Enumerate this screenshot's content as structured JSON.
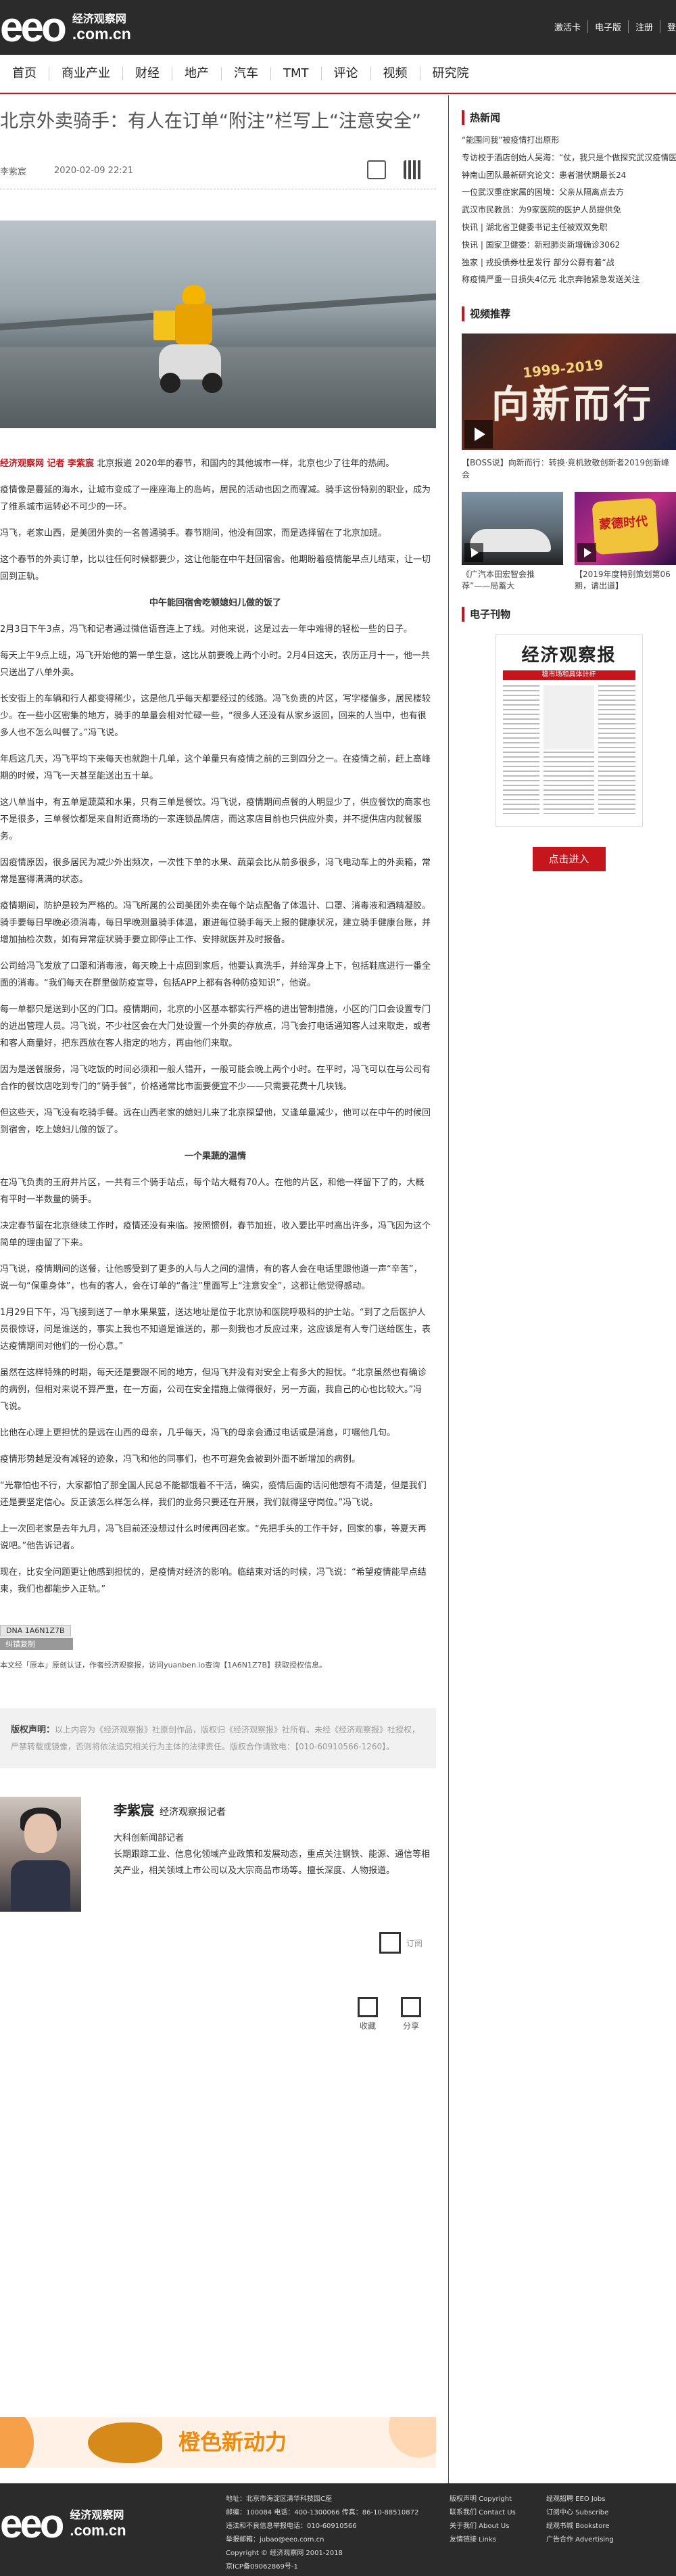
{
  "header": {
    "logo_mark": "eeo",
    "logo_cn": "经济观察网",
    "logo_en": ".com.cn",
    "links": [
      "激活卡",
      "电子版",
      "注册",
      "登"
    ]
  },
  "nav": [
    "首页",
    "商业产业",
    "财经",
    "地产",
    "汽车",
    "TMT",
    "评论",
    "视频",
    "研究院"
  ],
  "article": {
    "title": "北京外卖骑手：有人在订单“附注”栏写上“注意安全”",
    "author": "李紫宸",
    "date": "2020-02-09 22:21",
    "lead_source": "经济观察网 记者 李紫宸",
    "paragraphs": [
      "北京报道 2020年的春节，和国内的其他城市一样，北京也少了往年的热闹。",
      "疫情像是蔓延的海水，让城市变成了一座座海上的岛屿，居民的活动也因之而骤减。骑手这份特别的职业，成为了维系城市运转必不可少的一环。",
      "冯飞，老家山西，是美团外卖的一名普通骑手。春节期间，他没有回家，而是选择留在了北京加班。",
      "这个春节的外卖订单，比以往任何时候都要少，这让他能在中午赶回宿舍。他期盼着疫情能早点儿结束，让一切回到正轨。"
    ],
    "subhead1": "中午能回宿舍吃顿媳妇儿做的饭了",
    "paragraphs2": [
      "2月3日下午3点，冯飞和记者通过微信语音连上了线。对他来说，这是过去一年中难得的轻松一些的日子。",
      "每天上午9点上班，冯飞开始他的第一单生意，这比从前要晚上两个小时。2月4日这天，农历正月十一，他一共只送出了八单外卖。",
      "长安街上的车辆和行人都变得稀少，这是他几乎每天都要经过的线路。冯飞负责的片区，写字楼偏多，居民楼较少。在一些小区密集的地方，骑手的单量会相对忙碌一些，“很多人还没有从家乡返回，回来的人当中，也有很多人也不怎么叫餐了。”冯飞说。",
      "年后这几天，冯飞平均下来每天也就跑十几单，这个单量只有疫情之前的三到四分之一。在疫情之前，赶上高峰期的时候，冯飞一天甚至能送出五十单。",
      "这八单当中，有五单是蔬菜和水果，只有三单是餐饮。冯飞说，疫情期间点餐的人明显少了，供应餐饮的商家也不是很多，三单餐饮都是来自附近商场的一家连锁品牌店，而这家店目前也只供应外卖，并不提供店内就餐服务。",
      "因疫情原因，很多居民为减少外出频次，一次性下单的水果、蔬菜会比从前多很多，冯飞电动车上的外卖箱，常常是塞得满满的状态。",
      "疫情期间，防护是较为严格的。冯飞所属的公司美团外卖在每个站点配备了体温计、口罩、消毒液和酒精凝胶。骑手要每日早晚必须消毒，每日早晚测量骑手体温，跟进每位骑手每天上报的健康状况，建立骑手健康台账，并增加抽检次数，如有异常症状骑手要立即停止工作、安排就医并及时报备。",
      "公司给冯飞发放了口罩和消毒液，每天晚上十点回到家后，他要认真洗手，并给浑身上下，包括鞋底进行一番全面的消毒。“我们每天在群里做防疫宣导，包括APP上都有各种防疫知识”，他说。",
      "每一单都只是送到小区的门口。疫情期间，北京的小区基本都实行严格的进出管制措施，小区的门口会设置专门的进出管理人员。冯飞说，不少社区会在大门处设置一个外卖的存放点，冯飞会打电话通知客人过来取走，或者和客人商量好，把东西放在客人指定的地方，再由他们来取。",
      "因为是送餐服务，冯飞吃饭的时间必须和一般人错开，一般可能会晚上两个小时。在平时，冯飞可以在与公司有合作的餐饮店吃到专门的“骑手餐”，价格通常比市面要便宜不少——只需要花费十几块钱。",
      "但这些天，冯飞没有吃骑手餐。远在山西老家的媳妇儿来了北京探望他，又逢单量减少，他可以在中午的时候回到宿舍，吃上媳妇儿做的饭了。"
    ],
    "subhead2": "一个果蔬的温情",
    "paragraphs3": [
      "在冯飞负责的王府井片区，一共有三个骑手站点，每个站大概有70人。在他的片区，和他一样留下了的，大概有平时一半数量的骑手。",
      "决定春节留在北京继续工作时，疫情还没有来临。按照惯例，春节加班，收入要比平时高出许多，冯飞因为这个简单的理由留了下来。",
      "冯飞说，疫情期间的送餐，让他感受到了更多的人与人之间的温情，有的客人会在电话里跟他道一声“辛苦”，说一句“保重身体”，也有的客人，会在订单的“备注”里面写上“注意安全”，这都让他觉得感动。",
      "1月29日下午，冯飞接到送了一单水果果篮，送达地址是位于北京协和医院呼吸科的护士站。“到了之后医护人员很惊讶，问是谁送的，事实上我也不知道是谁送的，那一刻我也才反应过来，这应该是有人专门送给医生，表达疫情期间对他们的一份心意。”",
      "虽然在这样特殊的时期，每天还是要跟不同的地方，但冯飞并没有对安全上有多大的担忧。“北京虽然也有确诊的病例，但相对来说不算严重，在一方面，公司在安全措施上做得很好，另一方面，我自己的心也比较大。”冯飞说。",
      "比他在心理上更担忧的是远在山西的母亲，几乎每天，冯飞的母亲会通过电话或是消息，叮嘱他几句。",
      "疫情形势越是没有减轻的迹象，冯飞和他的同事们，也不可避免会被到外面不断增加的病例。",
      "“光靠怕也不行，大家都怕了那全国人民总不能都饿着不干活，确实，疫情后面的话问他想有不清楚，但是我们还是要坚定信心。反正该怎么样怎么样，我们的业务只要还在开展，我们就得坚守岗位。”冯飞说。",
      "上一次回老家是去年九月，冯飞目前还没想过什么时候再回老家。“先把手头的工作干好，回家的事，等夏天再说吧。”他告诉记者。",
      "现在，比安全问题更让他感到担忧的，是疫情对经济的影响。临结束对话的时候，冯飞说：“希望疫情能早点结束，我们也都能步入正轨。”"
    ],
    "dna_label": "DNA 1A6N1Z7B",
    "dna_sub": "纠错复制",
    "copyright_line": "本文经「原本」原创认证，作者经济观察报，访问yuanben.io查询【1A6N1Z7B】获取授权信息。",
    "rights_title": "版权声明：",
    "rights_text": "以上内容为《经济观察报》社原创作品，版权归《经济观察报》社所有。未经《经济观察报》社授权，严禁转载或镜像，否则将依法追究相关行为主体的法律责任。版权合作请致电：【010-60910566-1260】。",
    "author_box": {
      "name": "李紫宸",
      "role": "经济观察报记者",
      "title": "大科创新闻部记者",
      "bio": "长期跟踪工业、信息化领域产业政策和发展动态，重点关注钢铁、能源、通信等相关产业，相关领域上市公司以及大宗商品市场等。擅长深度、人物报道。"
    },
    "subscribe_label": "订阅",
    "collect_label": "收藏",
    "share_label": "分享",
    "banner_text": "橙色新动力"
  },
  "sidebar": {
    "hot_title": "热新闻",
    "hot_items": [
      "“能围问我”被疫情打出原形",
      "专访校于酒店创始人吴海：“仗，我只是个做探究武汉疫情医护健康",
      "钟南山团队最新研究论文：患者潜伏期最长24",
      "一位武汉重症家属的困境：父亲从隔离点去方",
      "武汉市民教员：为9家医院的医护人员提供免",
      "快讯 | 湖北省卫健委书记主任被双双免职",
      "快讯 | 国家卫健委：新冠肺炎新增确诊3062",
      "独家 | 戎投债券杜星发行 部分公募有着“战",
      "称疫情严重一日损失4亿元 北京奔驰紧急发送关注"
    ],
    "video_title": "视频推荐",
    "video_big_t1": "1999-2019",
    "video_big_t2": "向新而行",
    "video_big_caption": "【BOSS说】向新而行：转换·竞机致敬创新者2019创新峰会",
    "video_small": [
      {
        "caption": "《广汽本田宏智会推荐”——局蓄大",
        "badge": ""
      },
      {
        "caption": "【2019年度特别策划第06期，请出道】",
        "badge": "蒙德时代"
      }
    ],
    "paper_title": "电子刊物",
    "paper_name": "经济观察报",
    "paper_head": "稳市场和具体计杆",
    "enter_label": "点击进入"
  },
  "footer": {
    "address": [
      "地址：北京市海淀区清华科技园C座",
      "邮编：100084 电话：400-1300066 传真：86-10-88510872",
      "违法和不良信息举报电话：010-60910566",
      "举报邮箱：jubao@eeo.com.cn",
      "Copyright © 经济观察网 2001-2018",
      "京ICP备09062869号-1"
    ],
    "links1": [
      "版权声明 Copyright",
      "联系我们 Contact Us",
      "关于我们 About Us",
      "友情链接 Links"
    ],
    "links2": [
      "经观招聘 EEO Jobs",
      "订阅中心 Subscribe",
      "经观书城 Bookstore",
      "广告合作 Advertising"
    ]
  }
}
